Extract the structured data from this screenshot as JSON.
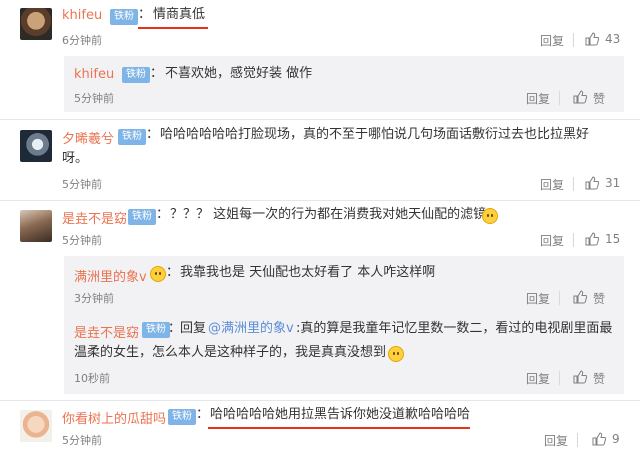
{
  "comments": [
    {
      "user": "khifeu",
      "badge": "铁粉",
      "sep": "：",
      "text": "情商真低",
      "time": "6分钟前",
      "reply": "回复",
      "likes": "43",
      "subreplies": [
        {
          "user": "khifeu",
          "badge": "铁粉",
          "sep": "：",
          "text": "不喜欢她，感觉好装 做作",
          "time": "5分钟前",
          "reply": "回复",
          "likes": "赞"
        }
      ]
    },
    {
      "user": "夕晞羲兮",
      "badge": "铁粉",
      "sep": "：",
      "text_line1": "哈哈哈哈哈哈打脸现场，真的不至于哪怕说几句场面话敷衍过去也比拉黑好",
      "text_line2": "呀。",
      "time": "5分钟前",
      "reply": "回复",
      "likes": "31"
    },
    {
      "user": "是垚不是窈",
      "badge": "铁粉",
      "sep": "：",
      "text": "？？？ 这姐每一次的行为都在消费我对她天仙配的滤镜",
      "time": "5分钟前",
      "reply": "回复",
      "likes": "15",
      "subreplies": [
        {
          "user": "满洲里的象v",
          "badge": "铁粉",
          "sep": "：",
          "text": "我靠我也是 天仙配也太好看了 本人咋这样啊",
          "time": "3分钟前",
          "reply": "回复",
          "likes": "赞"
        },
        {
          "user": "是垚不是窈",
          "badge": "铁粉",
          "sep": "：",
          "reply_prefix": "回复",
          "mention": "@满洲里的象v",
          "text_line1": ":真的算是我童年记忆里数一数二，看过的电视剧里面最",
          "text_line2": "温柔的女生，怎么本人是这种样子的，我是真真没想到",
          "time": "10秒前",
          "reply": "回复",
          "likes": "赞"
        }
      ]
    },
    {
      "user": "你看树上的瓜甜吗",
      "badge": "铁粉",
      "sep": "：",
      "text": "哈哈哈哈哈她用拉黑告诉你她没道歉哈哈哈哈",
      "time": "5分钟前",
      "reply": "回复",
      "likes": "9"
    }
  ],
  "colors": {
    "username": "#eb7350",
    "mention": "#5a8fd8",
    "badge": "#7fb4e6",
    "highlight": "#e8311b"
  }
}
